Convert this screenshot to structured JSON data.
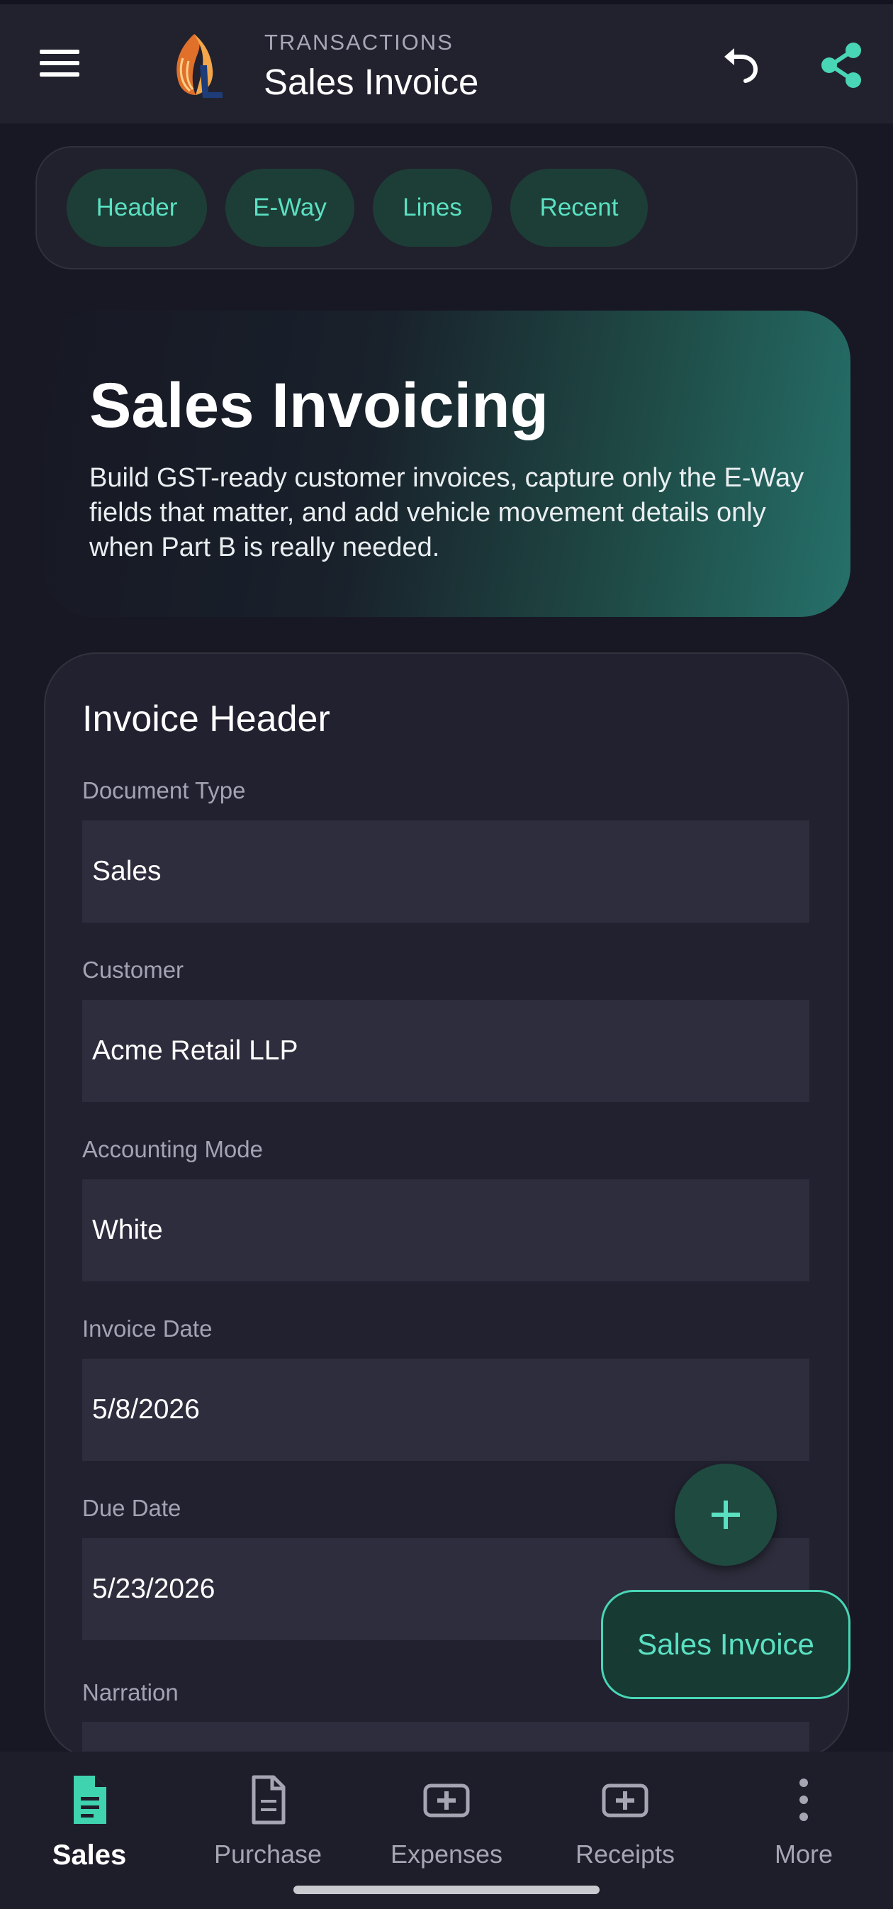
{
  "colors": {
    "background": "#181824",
    "surface": "#212130",
    "field": "#2d2d3d",
    "accent": "#5be0c2",
    "chip_bg": "#1d3e37"
  },
  "appbar": {
    "overline": "TRANSACTIONS",
    "title": "Sales Invoice",
    "icons": [
      "menu-icon",
      "app-logo",
      "undo-icon",
      "share-icon"
    ]
  },
  "chips": [
    {
      "label": "Header"
    },
    {
      "label": "E-Way"
    },
    {
      "label": "Lines"
    },
    {
      "label": "Recent"
    }
  ],
  "hero": {
    "title": "Sales Invoicing",
    "description": "Build GST-ready customer invoices, capture only the E-Way fields that matter, and add vehicle movement details only when Part B is really needed."
  },
  "form": {
    "title": "Invoice Header",
    "fields": [
      {
        "label": "Document Type",
        "value": "Sales"
      },
      {
        "label": "Customer",
        "value": "Acme Retail LLP"
      },
      {
        "label": "Accounting Mode",
        "value": "White"
      },
      {
        "label": "Invoice Date",
        "value": "5/8/2026"
      },
      {
        "label": "Due Date",
        "value": "5/23/2026"
      },
      {
        "label": "Narration",
        "value": ""
      }
    ]
  },
  "fab": {
    "icon": "plus-icon"
  },
  "extended_button": {
    "label": "Sales Invoice"
  },
  "bottom_nav": {
    "active": "Sales",
    "items": [
      {
        "label": "Sales",
        "icon": "document-icon"
      },
      {
        "label": "Purchase",
        "icon": "document-outline-icon"
      },
      {
        "label": "Expenses",
        "icon": "add-box-icon"
      },
      {
        "label": "Receipts",
        "icon": "add-box-icon"
      },
      {
        "label": "More",
        "icon": "more-vertical-icon"
      }
    ]
  }
}
